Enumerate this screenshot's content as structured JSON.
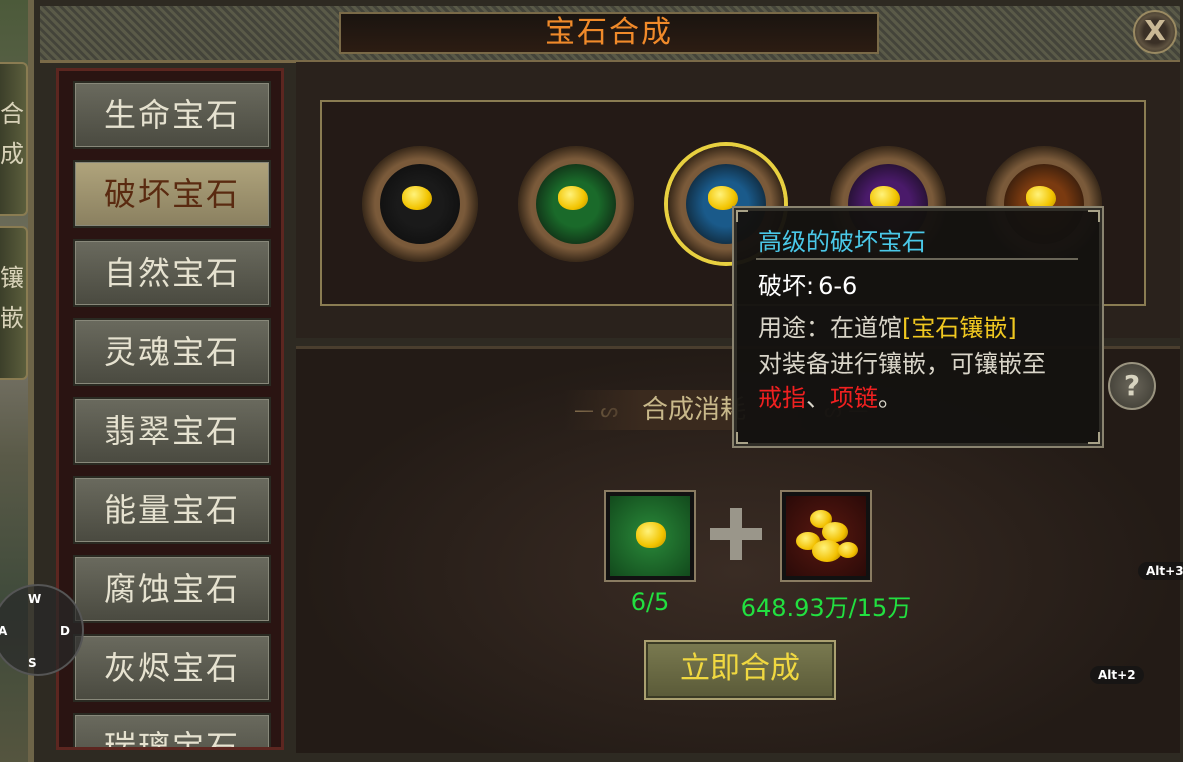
{
  "window": {
    "title": "宝石合成",
    "close_label": "X"
  },
  "side_tabs": [
    {
      "label": "合成"
    },
    {
      "label": "镶嵌"
    }
  ],
  "categories": [
    {
      "label": "生命宝石",
      "active": false
    },
    {
      "label": "破坏宝石",
      "active": true
    },
    {
      "label": "自然宝石",
      "active": false
    },
    {
      "label": "灵魂宝石",
      "active": false
    },
    {
      "label": "翡翠宝石",
      "active": false
    },
    {
      "label": "能量宝石",
      "active": false
    },
    {
      "label": "腐蚀宝石",
      "active": false
    },
    {
      "label": "灰烬宝石",
      "active": false
    },
    {
      "label": "瑞璃宝石",
      "active": false
    }
  ],
  "gem_levels": [
    {
      "color": "#1a1a1a",
      "selected": false
    },
    {
      "color": "#1a6a2a",
      "selected": false
    },
    {
      "color": "#1a5a8a",
      "selected": true
    },
    {
      "color": "#4a1a6a",
      "selected": false
    },
    {
      "color": "#7a3a10",
      "selected": false
    }
  ],
  "tooltip": {
    "title": "高级的破坏宝石",
    "stat_key": "破坏:",
    "stat_value": "6-6",
    "usage_prefix": "用途：在道馆",
    "usage_link": "[宝石镶嵌]",
    "line2": "对装备进行镶嵌，可镶嵌至",
    "item1": "戒指",
    "sep": "、",
    "item2": "项链",
    "end": "。"
  },
  "cost": {
    "label": "合成消耗",
    "help_label": "?",
    "gem_count": "6/5",
    "gold_count": "648.93万/15万"
  },
  "compose_button": "立即合成",
  "compass": {
    "n": "W",
    "w": "A",
    "e": "D",
    "s": "S"
  },
  "hotkeys": {
    "alt3": "Alt+3",
    "alt2": "Alt+2"
  }
}
